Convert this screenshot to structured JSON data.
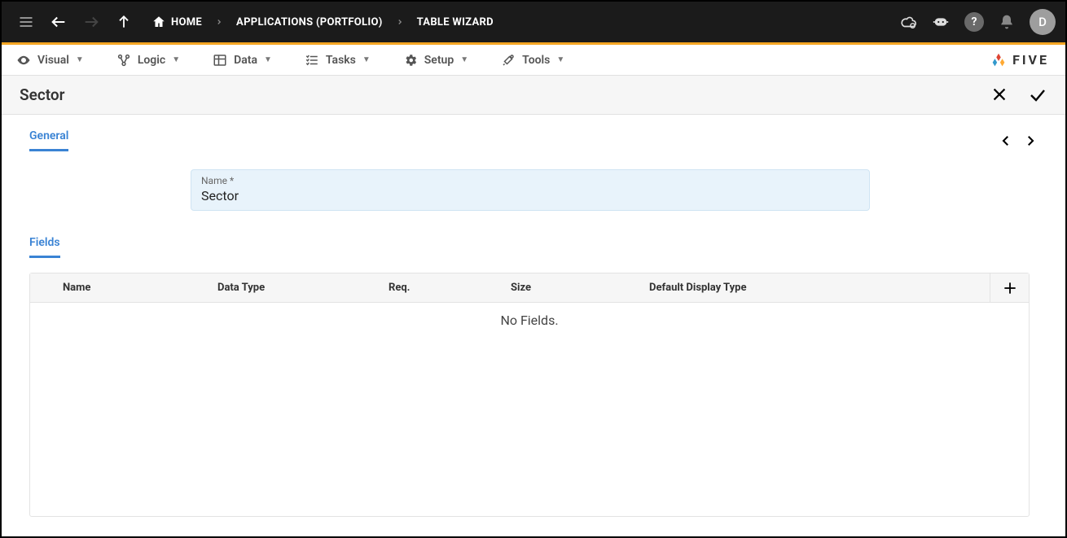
{
  "breadcrumb": {
    "home": "HOME",
    "applications": "APPLICATIONS (PORTFOLIO)",
    "tablewizard": "TABLE WIZARD"
  },
  "avatar": {
    "initial": "D"
  },
  "menu": {
    "visual": "Visual",
    "logic": "Logic",
    "data": "Data",
    "tasks": "Tasks",
    "setup": "Setup",
    "tools": "Tools"
  },
  "brand": "FIVE",
  "page": {
    "title": "Sector"
  },
  "tabs": {
    "general": "General",
    "fields": "Fields"
  },
  "form": {
    "name_label": "Name *",
    "name_value": "Sector"
  },
  "table": {
    "headers": {
      "name": "Name",
      "datatype": "Data Type",
      "req": "Req.",
      "size": "Size",
      "display": "Default Display Type"
    },
    "empty": "No Fields."
  }
}
